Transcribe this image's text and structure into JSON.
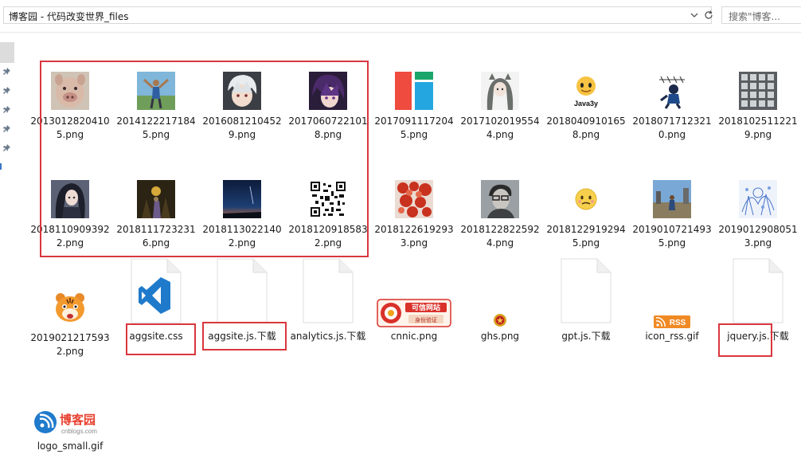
{
  "address": {
    "path": "博客园 - 代码改变世界_files"
  },
  "search": {
    "placeholder": "搜索\"博客..."
  },
  "files": [
    {
      "name": "20130128204105.png",
      "line1": "2013012820410",
      "line2": "5.png",
      "icon": "pig-photo-icon"
    },
    {
      "name": "20141222171845.png",
      "line1": "2014122217184",
      "line2": "5.png",
      "icon": "person-photo-icon"
    },
    {
      "name": "20160812104529.png",
      "line1": "2016081210452",
      "line2": "9.png",
      "icon": "anime-avatar-icon"
    },
    {
      "name": "20170607221018.png",
      "line1": "2017060722101",
      "line2": "8.png",
      "icon": "anime-avatar-icon"
    },
    {
      "name": "20170911172045.png",
      "line1": "2017091117204",
      "line2": "5.png",
      "icon": "color-blocks-icon"
    },
    {
      "name": "20171020195544.png",
      "line1": "2017102019554",
      "line2": "4.png",
      "icon": "anime-girl-icon"
    },
    {
      "name": "20180409101658.png",
      "line1": "2018040910165",
      "line2": "8.png",
      "icon": "java3y-emoji-icon"
    },
    {
      "name": "20180717123210.png",
      "line1": "2018071712321",
      "line2": "0.png",
      "icon": "cartoon-icon"
    },
    {
      "name": "20181025112219.png",
      "line1": "2018102511221",
      "line2": "9.png",
      "icon": "grid-photo-icon"
    },
    {
      "name": "20181109093922.png",
      "line1": "2018110909392",
      "line2": "2.png",
      "icon": "anime-girl-icon"
    },
    {
      "name": "20181117232316.png",
      "line1": "2018111723231",
      "line2": "6.png",
      "icon": "night-photo-icon"
    },
    {
      "name": "20181130221402.png",
      "line1": "2018113022140",
      "line2": "2.png",
      "icon": "sky-photo-icon"
    },
    {
      "name": "20181209185832.png",
      "line1": "2018120918583",
      "line2": "2.png",
      "icon": "qr-code-icon"
    },
    {
      "name": "20181226192933.png",
      "line1": "2018122619293",
      "line2": "3.png",
      "icon": "red-leaves-icon"
    },
    {
      "name": "20181228225924.png",
      "line1": "2018122822592",
      "line2": "4.png",
      "icon": "portrait-sketch-icon"
    },
    {
      "name": "20181229192945.png",
      "line1": "2018122919294",
      "line2": "5.png",
      "icon": "emoji-face-icon"
    },
    {
      "name": "20190107214935.png",
      "line1": "2019010721493",
      "line2": "5.png",
      "icon": "outdoor-photo-icon"
    },
    {
      "name": "20190129080513.png",
      "line1": "2019012908051",
      "line2": "3.png",
      "icon": "blue-sketch-icon"
    },
    {
      "name": "20190212175932.png",
      "line1": "2019021217593",
      "line2": "2.png",
      "icon": "tiger-cartoon-icon"
    },
    {
      "name": "aggsite.css",
      "line1": "aggsite.css",
      "line2": "",
      "icon": "vscode-file-icon"
    },
    {
      "name": "aggsite.js.下载",
      "line1": "aggsite.js.下载",
      "line2": "",
      "icon": "blank-file-icon"
    },
    {
      "name": "analytics.js.下载",
      "line1": "analytics.js.下载",
      "line2": "",
      "icon": "blank-file-icon"
    },
    {
      "name": "cnnic.png",
      "line1": "cnnic.png",
      "line2": "",
      "icon": "cnnic-badge-icon"
    },
    {
      "name": "ghs.png",
      "line1": "ghs.png",
      "line2": "",
      "icon": "police-badge-icon"
    },
    {
      "name": "gpt.js.下载",
      "line1": "gpt.js.下载",
      "line2": "",
      "icon": "blank-file-icon"
    },
    {
      "name": "icon_rss.gif",
      "line1": "icon_rss.gif",
      "line2": "",
      "icon": "rss-icon"
    },
    {
      "name": "jquery.js.下载",
      "line1": "jquery.js.下载",
      "line2": "",
      "icon": "blank-file-icon"
    },
    {
      "name": "logo_small.gif",
      "line1": "logo_small.gif",
      "line2": "",
      "icon": "cnblogs-logo-icon"
    }
  ],
  "badges": {
    "cnnic_top": "可信网站",
    "cnnic_bottom": "身份验证",
    "java3y": "Java3y",
    "rss": "RSS",
    "cnblogs_brand": "博客园",
    "cnblogs_domain": "cnblogs.com"
  },
  "colors": {
    "highlight": "#d9363e",
    "vscode": "#1f7acb",
    "rss": "#f08a24",
    "cnnic": "#d9322b"
  }
}
